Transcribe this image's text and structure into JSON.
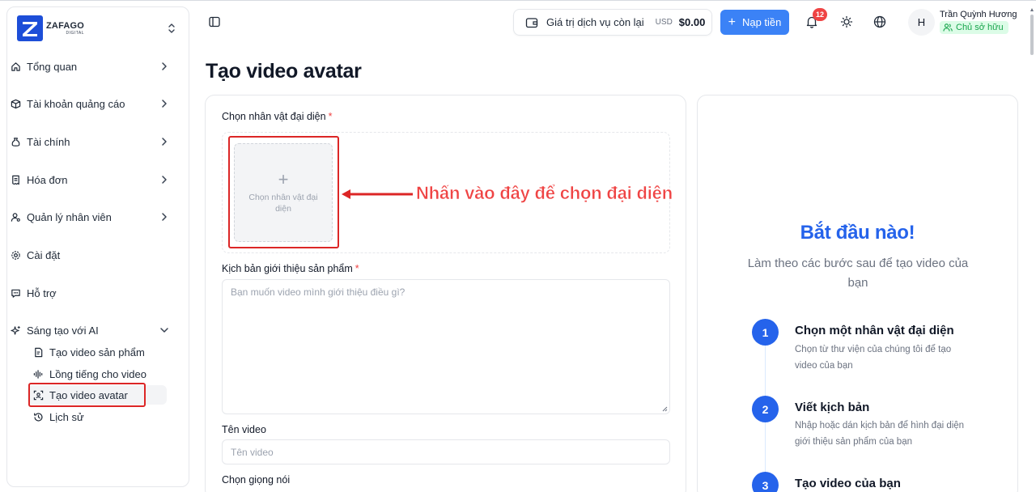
{
  "brand": {
    "name": "ZAFAGO",
    "sub": "DIGITAL"
  },
  "sidebar": {
    "items": [
      {
        "label": "Tổng quan",
        "icon": "home-icon"
      },
      {
        "label": "Tài khoản quảng cáo",
        "icon": "box-icon"
      },
      {
        "label": "Tài chính",
        "icon": "money-bag-icon"
      },
      {
        "label": "Hóa đơn",
        "icon": "receipt-icon"
      },
      {
        "label": "Quản lý nhân viên",
        "icon": "user-cog-icon"
      },
      {
        "label": "Cài đặt",
        "icon": "settings-icon"
      },
      {
        "label": "Hỗ trợ",
        "icon": "message-icon"
      },
      {
        "label": "Sáng tạo với AI",
        "icon": "sparkles-icon"
      }
    ],
    "ai_sub": [
      {
        "label": "Tạo video sản phẩm",
        "icon": "file-video-icon"
      },
      {
        "label": "Lồng tiếng cho video",
        "icon": "audio-wave-icon"
      },
      {
        "label": "Tạo video avatar",
        "icon": "scan-face-icon",
        "active": true
      },
      {
        "label": "Lịch sử",
        "icon": "history-icon"
      }
    ]
  },
  "header": {
    "balance_label": "Giá trị dịch vụ còn lại",
    "currency": "USD",
    "balance_amount": "$0.00",
    "topup_label": "Nạp tiền",
    "notification_count": "12",
    "avatar_initial": "H",
    "user_name": "Trần Quỳnh Hương",
    "user_role": "Chủ sở hữu"
  },
  "page": {
    "title": "Tạo video avatar"
  },
  "form": {
    "avatar_label": "Chọn nhân vật đại diện",
    "required_mark": "*",
    "upload_text": "Chọn nhân vật đại diện",
    "callout": "Nhấn vào đây để chọn đại diện",
    "script_label": "Kịch bản giới thiệu sản phẩm",
    "script_placeholder": "Bạn muốn video mình giới thiệu điều gì?",
    "video_name_label": "Tên video",
    "video_name_placeholder": "Tên video",
    "voice_label": "Chọn giọng nói"
  },
  "guide": {
    "title": "Bắt đầu nào!",
    "subtitle": "Làm theo các bước sau để tạo video của bạn",
    "steps": [
      {
        "num": "1",
        "title": "Chọn một nhân vật đại diện",
        "desc": "Chọn từ thư viện của chúng tôi để tạo video của bạn"
      },
      {
        "num": "2",
        "title": "Viết kịch bản",
        "desc": "Nhập hoặc dán kịch bản để hình đại diện giới thiệu sản phẩm của bạn"
      },
      {
        "num": "3",
        "title": "Tạo video của bạn",
        "desc": ""
      }
    ]
  },
  "colors": {
    "accent": "#2563eb",
    "button": "#3b82f6",
    "annotation": "#dc2626",
    "role_bg": "#dcfce7",
    "role_fg": "#16a34a"
  }
}
